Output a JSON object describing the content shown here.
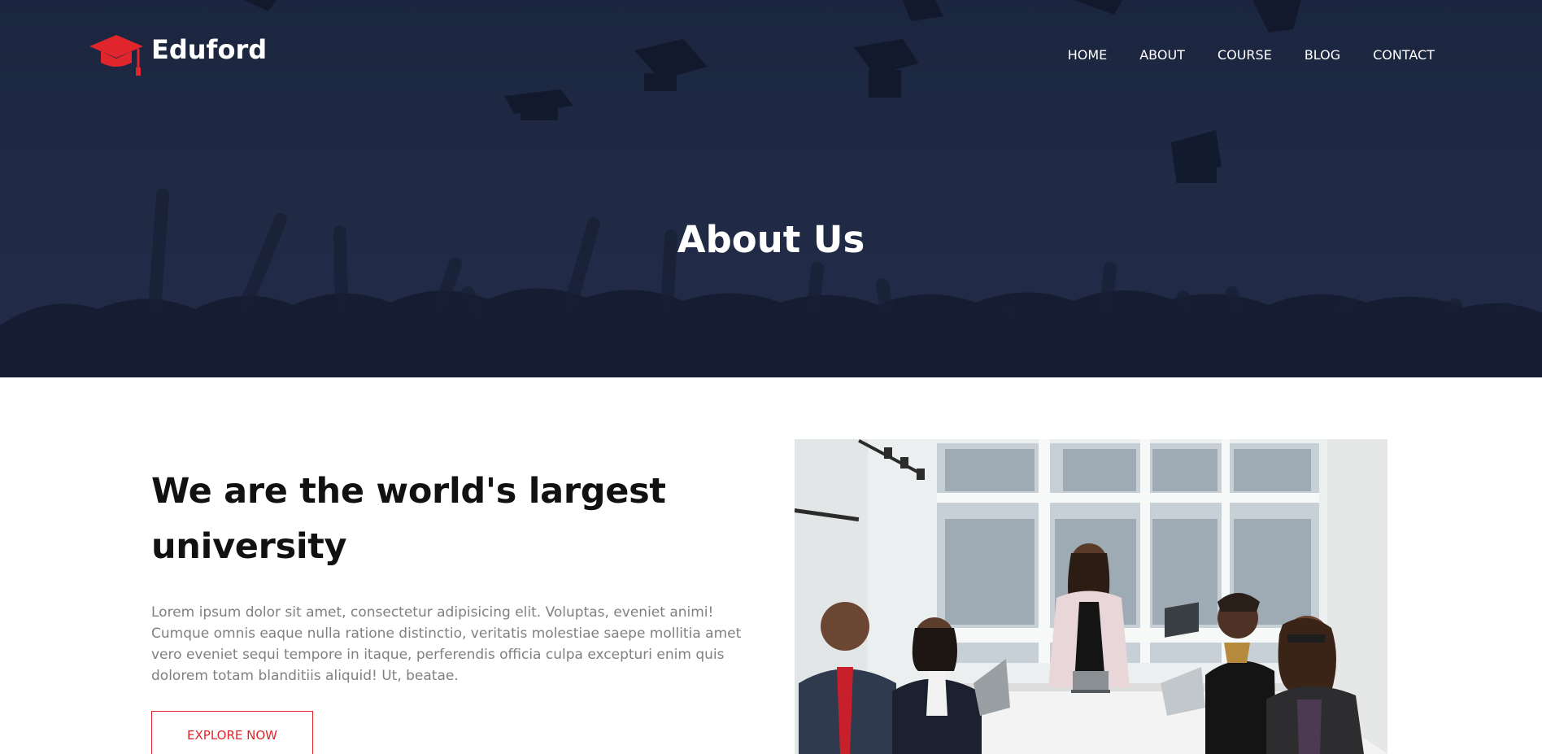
{
  "brand": {
    "name": "Eduford",
    "logo_icon": "graduation-cap-icon",
    "accent_color": "#e0262c"
  },
  "nav": {
    "items": [
      {
        "label": "HOME"
      },
      {
        "label": "ABOUT"
      },
      {
        "label": "COURSE"
      },
      {
        "label": "BLOG"
      },
      {
        "label": "CONTACT"
      }
    ]
  },
  "hero": {
    "title": "About Us",
    "background": "#27324f"
  },
  "about": {
    "heading_line1": "We are the world's largest",
    "heading_line2": "university",
    "body": "Lorem ipsum dolor sit amet, consectetur adipisicing elit. Voluptas, eveniet animi! Cumque omnis eaque nulla ratione distinctio, veritatis molestiae saepe mollitia amet vero eveniet sequi tempore in itaque, perferendis officia culpa excepturi enim quis dolorem totam blanditiis aliquid! Ut, beatae.",
    "cta_label": "EXPLORE NOW"
  }
}
